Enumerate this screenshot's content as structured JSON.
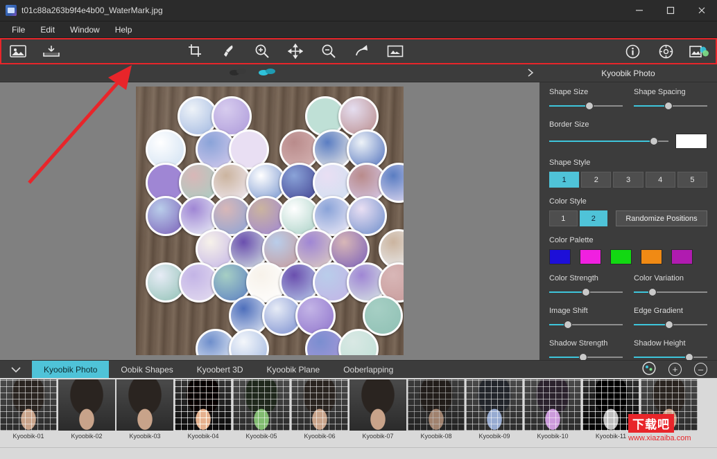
{
  "window": {
    "title": "t01c88a263b9f4e4b00_WaterMark.jpg",
    "app_icon": "image-app-icon",
    "minimize": "minimize-icon",
    "maximize": "maximize-icon",
    "close": "close-icon"
  },
  "menubar": {
    "items": [
      "File",
      "Edit",
      "Window",
      "Help"
    ]
  },
  "toolbar": {
    "accent_outline": "#e8252a",
    "buttons": [
      {
        "name": "open-image-button",
        "icon": "picture-icon",
        "tooltip": "Open Image"
      },
      {
        "name": "save-image-button",
        "icon": "save-tray-icon",
        "tooltip": "Save Image"
      },
      {
        "name": "crop-button",
        "icon": "crop-icon",
        "tooltip": "Crop"
      },
      {
        "name": "brush-button",
        "icon": "brush-icon",
        "tooltip": "Brush"
      },
      {
        "name": "zoom-in-button",
        "icon": "zoom-in-icon",
        "tooltip": "Zoom In"
      },
      {
        "name": "move-button",
        "icon": "move-arrows-icon",
        "tooltip": "Move"
      },
      {
        "name": "zoom-out-button",
        "icon": "zoom-out-icon",
        "tooltip": "Zoom Out"
      },
      {
        "name": "redo-button",
        "icon": "redo-arrow-icon",
        "tooltip": "Redo"
      },
      {
        "name": "reset-view-button",
        "icon": "image-frame-icon",
        "tooltip": "Reset View"
      },
      {
        "name": "info-button",
        "icon": "info-circle-icon",
        "tooltip": "Info"
      },
      {
        "name": "settings-button",
        "icon": "gear-circle-icon",
        "tooltip": "Settings"
      },
      {
        "name": "effects-button",
        "icon": "color-mask-icon",
        "tooltip": "Effects"
      }
    ]
  },
  "subbar": {
    "icons": [
      {
        "name": "shape-tool-a-icon",
        "icon": "shapes-dark-icon"
      },
      {
        "name": "shape-tool-b-icon",
        "icon": "shapes-cyan-icon"
      }
    ],
    "expand_chevron": "chevron-right-icon",
    "title": "Kyoobik Photo"
  },
  "panel": {
    "controls": [
      {
        "name": "shape-size",
        "label": "Shape Size",
        "value": 55
      },
      {
        "name": "shape-spacing",
        "label": "Shape Spacing",
        "value": 47
      },
      {
        "name": "border-size",
        "label": "Border Size",
        "value": 88
      },
      {
        "name": "color-strength",
        "label": "Color Strength",
        "value": 50
      },
      {
        "name": "color-variation",
        "label": "Color Variation",
        "value": 25
      },
      {
        "name": "image-shift",
        "label": "Image Shift",
        "value": 25
      },
      {
        "name": "edge-gradient",
        "label": "Edge Gradient",
        "value": 48
      },
      {
        "name": "shadow-strength",
        "label": "Shadow Strength",
        "value": 46
      },
      {
        "name": "shadow-height",
        "label": "Shadow Height",
        "value": 75
      }
    ],
    "border_color_label": "Border Size",
    "border_color_value": "#ffffff",
    "shape_style": {
      "label": "Shape Style",
      "options": [
        "1",
        "2",
        "3",
        "4",
        "5"
      ],
      "selected": "1"
    },
    "color_style": {
      "label": "Color Style",
      "options": [
        "1",
        "2"
      ],
      "selected": "2"
    },
    "randomize_button": "Randomize Positions",
    "color_palette": {
      "label": "Color Palette",
      "colors": [
        "#1d0fd8",
        "#f020e0",
        "#12d812",
        "#f08a14",
        "#b01bb0"
      ]
    }
  },
  "tabstrip": {
    "collapse_chevron": "chevron-down-icon",
    "tabs": [
      {
        "label": "Kyoobik Photo",
        "active": true
      },
      {
        "label": "Oobik Shapes",
        "active": false
      },
      {
        "label": "Kyoobert 3D",
        "active": false
      },
      {
        "label": "Kyoobik Plane",
        "active": false
      },
      {
        "label": "Ooberlapping",
        "active": false
      }
    ],
    "right_buttons": [
      {
        "name": "palette-circle-button",
        "icon": "palette-circle-icon"
      },
      {
        "name": "add-preset-button",
        "icon": "plus-circle-icon"
      },
      {
        "name": "remove-preset-button",
        "icon": "minus-circle-icon"
      }
    ]
  },
  "filmstrip": {
    "items": [
      {
        "label": "Kyoobik-01"
      },
      {
        "label": "Kyoobik-02"
      },
      {
        "label": "Kyoobik-03"
      },
      {
        "label": "Kyoobik-04"
      },
      {
        "label": "Kyoobik-05"
      },
      {
        "label": "Kyoobik-06"
      },
      {
        "label": "Kyoobik-07"
      },
      {
        "label": "Kyoobik-08"
      },
      {
        "label": "Kyoobik-09"
      },
      {
        "label": "Kyoobik-10"
      },
      {
        "label": "Kyoobik-11"
      },
      {
        "label": ""
      }
    ]
  },
  "watermark": {
    "line1": "下载吧",
    "line2": "www.xiazaiba.com",
    "color": "#e8252a"
  },
  "annotation": {
    "arrow_color": "#e8252a",
    "target": "toolbar"
  }
}
